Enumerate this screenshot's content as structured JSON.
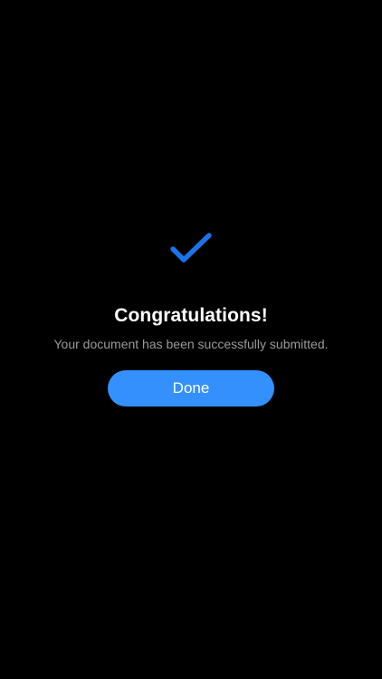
{
  "colors": {
    "background": "#000000",
    "accent": "#3490fc",
    "check": "#1a73e8",
    "title": "#ffffff",
    "subtitle": "#9a9a9e"
  },
  "success": {
    "icon": "checkmark-icon",
    "title": "Congratulations!",
    "message": "Your document has been successfully submitted.",
    "done_label": "Done"
  }
}
